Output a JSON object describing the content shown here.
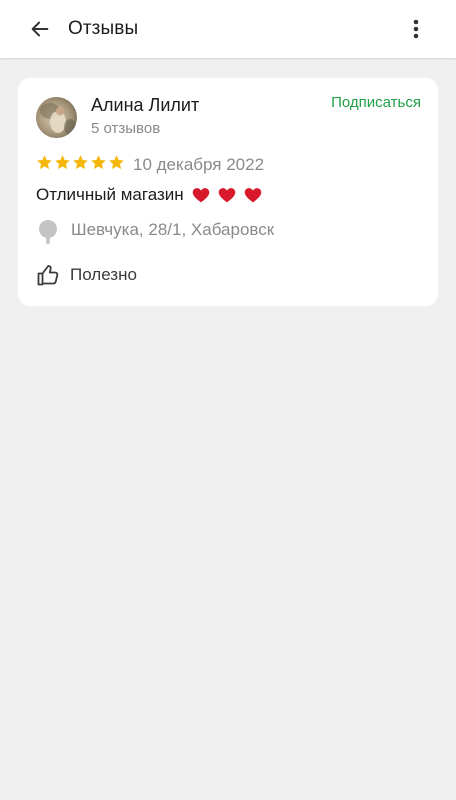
{
  "appbar": {
    "title": "Отзывы",
    "back_icon": "arrow-left-icon",
    "menu_icon": "more-vertical-icon"
  },
  "review": {
    "author": "Алина Лилит",
    "review_count": "5 отзывов",
    "subscribe_label": "Подписаться",
    "rating": 5,
    "rating_max": 5,
    "date": "10 декабря 2022",
    "text": "Отличный магазин",
    "emoji": [
      "red-heart",
      "red-heart",
      "red-heart"
    ],
    "address": "Шевчука, 28/1, Хабаровск",
    "useful_label": "Полезно"
  },
  "colors": {
    "background": "#f0f0f0",
    "card": "#ffffff",
    "accent_green": "#20a047",
    "star": "#f5b70a",
    "heart": "#d7192b",
    "secondary_text": "#8a8a8a"
  }
}
